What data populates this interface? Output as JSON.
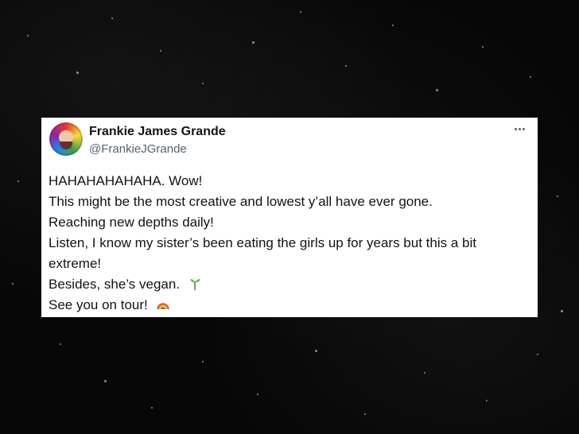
{
  "tweet": {
    "author": {
      "display_name": "Frankie James Grande",
      "handle": "@FrankieJGrande"
    },
    "text_lines": [
      "HAHAHAHAHAHA. Wow!",
      "This might be the most creative and lowest y’all have ever gone.",
      "Reaching new depths daily!",
      "Listen, I know my sister’s been eating the girls up for years but this a bit",
      "extreme!",
      "Besides, she’s vegan.",
      "See you on tour!"
    ],
    "emojis": {
      "seedling": "seedling-icon",
      "rainbow": "rainbow-icon"
    }
  }
}
